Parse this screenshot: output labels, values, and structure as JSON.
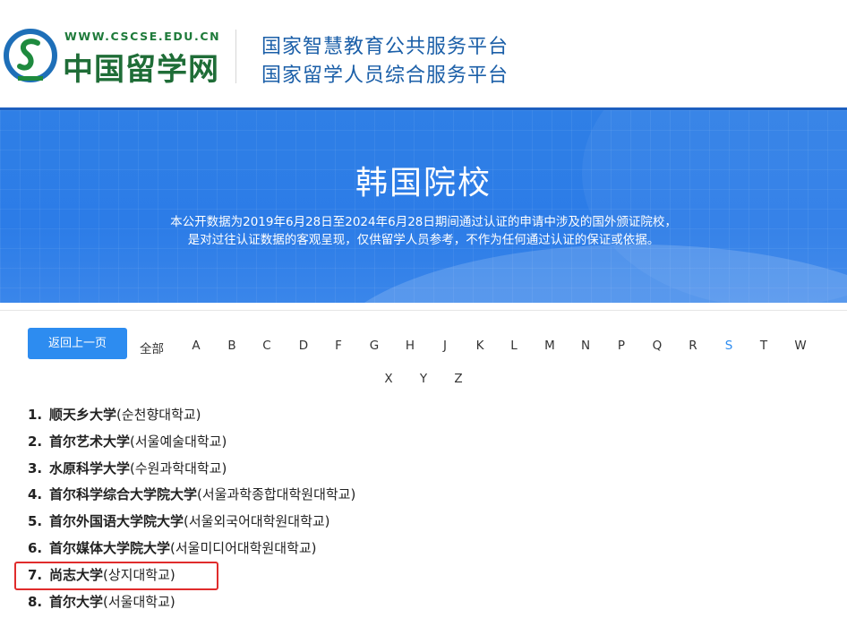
{
  "header": {
    "logo_url": "WWW.CSCSE.EDU.CN",
    "logo_name": "中国留学网",
    "platform_line1": "国家智慧教育公共服务平台",
    "platform_line2": "国家留学人员综合服务平台"
  },
  "banner": {
    "title": "韩国院校",
    "desc_line1": "本公开数据为2019年6月28日至2024年6月28日期间通过认证的申请中涉及的国外颁证院校，",
    "desc_line2": "是对过往认证数据的客观呈现，仅供留学人员参考，不作为任何通过认证的保证或依据。"
  },
  "nav": {
    "back_label": "返回上一页",
    "all_label": "全部",
    "letters_row1": [
      "A",
      "B",
      "C",
      "D",
      "F",
      "G",
      "H",
      "J",
      "K",
      "L",
      "M",
      "N",
      "P",
      "Q",
      "R",
      "S",
      "T",
      "W"
    ],
    "letters_row2": [
      "X",
      "Y",
      "Z"
    ],
    "active_letter": "S",
    "active_color": "#2d8cf0"
  },
  "schools": [
    {
      "num": "1.",
      "cn": "顺天乡大学",
      "kr": "(순천향대학교)"
    },
    {
      "num": "2.",
      "cn": "首尔艺术大学",
      "kr": "(서울예술대학교)"
    },
    {
      "num": "3.",
      "cn": "水原科学大学",
      "kr": "(수원과학대학교)"
    },
    {
      "num": "4.",
      "cn": "首尔科学综合大学院大学",
      "kr": "(서울과학종합대학원대학교)"
    },
    {
      "num": "5.",
      "cn": "首尔外国语大学院大学",
      "kr": "(서울외국어대학원대학교)"
    },
    {
      "num": "6.",
      "cn": "首尔媒体大学院大学",
      "kr": "(서울미디어대학원대학교)"
    },
    {
      "num": "7.",
      "cn": "尚志大学",
      "kr": "(상지대학교)"
    },
    {
      "num": "8.",
      "cn": "首尔大学",
      "kr": "(서울대학교)"
    }
  ],
  "highlight_color": "#e02c2c"
}
